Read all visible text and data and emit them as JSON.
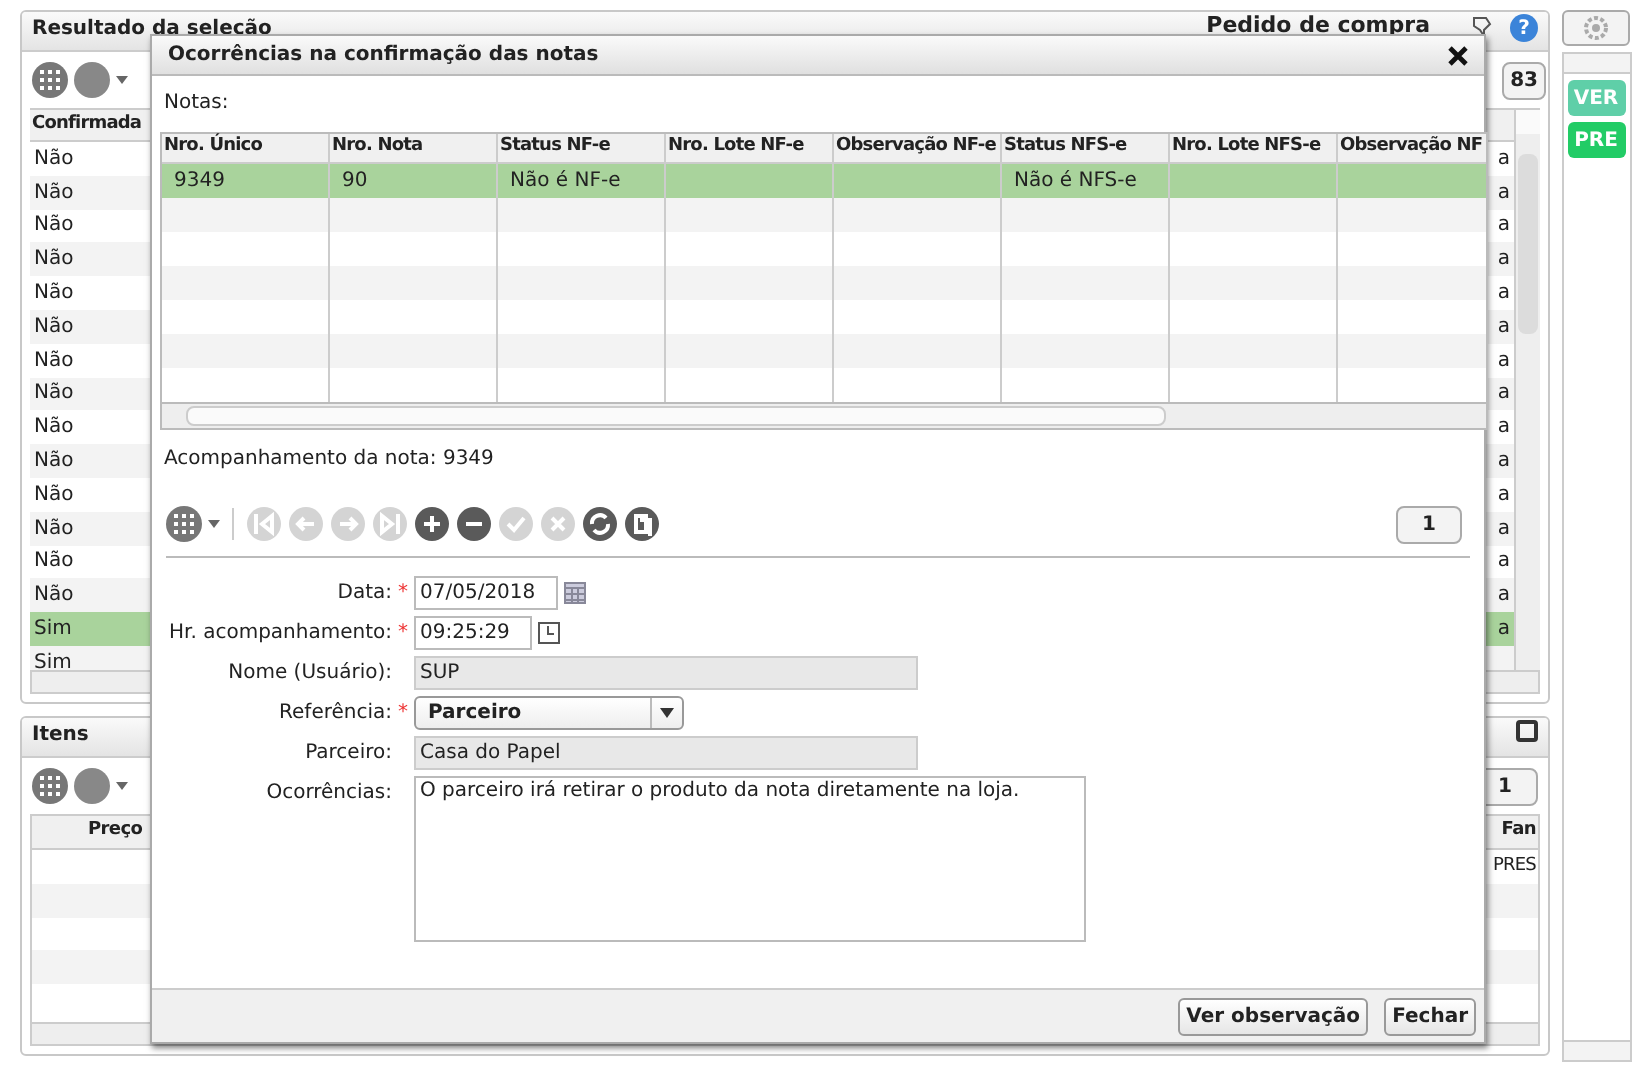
{
  "selection_panel": {
    "title": "Resultado da seleção",
    "context": "Pedido de compra",
    "help_label": "?",
    "page_badge": "83",
    "column": "Confirmada",
    "rows": [
      {
        "value": "Não",
        "column_2": "a",
        "selected": false
      },
      {
        "value": "Não",
        "column_2": "a",
        "selected": false
      },
      {
        "value": "Não",
        "column_2": "a",
        "selected": false
      },
      {
        "value": "Não",
        "column_2": "a",
        "selected": false
      },
      {
        "value": "Não",
        "column_2": "a",
        "selected": false
      },
      {
        "value": "Não",
        "column_2": "a",
        "selected": false
      },
      {
        "value": "Não",
        "column_2": "a",
        "selected": false
      },
      {
        "value": "Não",
        "column_2": "a",
        "selected": false
      },
      {
        "value": "Não",
        "column_2": "a",
        "selected": false
      },
      {
        "value": "Não",
        "column_2": "a",
        "selected": false
      },
      {
        "value": "Não",
        "column_2": "a",
        "selected": false
      },
      {
        "value": "Não",
        "column_2": "a",
        "selected": false
      },
      {
        "value": "Não",
        "column_2": "a",
        "selected": false
      },
      {
        "value": "Não",
        "column_2": "a",
        "selected": false
      },
      {
        "value": "Sim",
        "column_2": "a",
        "selected": true
      },
      {
        "value": "Sim",
        "selected": false
      }
    ]
  },
  "items_panel": {
    "title": "Itens",
    "page_badge": "1",
    "columns": [
      "Preço",
      "Fan"
    ],
    "rows": [
      {
        "cells": [
          "",
          "PRES"
        ]
      }
    ]
  },
  "sidebar": {
    "buttons": [
      {
        "label": "VER",
        "color": "#5fcfa8"
      },
      {
        "label": "PRE",
        "color": "#22cc66"
      }
    ]
  },
  "dialog": {
    "title": "Ocorrências na confirmação das notas",
    "notes_label": "Notas:",
    "columns": [
      "Nro. Único",
      "Nro. Nota",
      "Status NF-e",
      "Nro. Lote NF-e",
      "Observação NF-e",
      "Status NFS-e",
      "Nro. Lote NFS-e",
      "Observação NF"
    ],
    "rows": [
      {
        "cells": [
          "9349",
          "90",
          "Não é NF-e",
          "",
          "",
          "Não é NFS-e",
          "",
          ""
        ],
        "selected": true
      }
    ],
    "followup_label": "Acompanhamento da nota: 9349",
    "tools": [
      {
        "kind": "first",
        "disabled": true
      },
      {
        "kind": "prev",
        "disabled": true
      },
      {
        "kind": "next",
        "disabled": true
      },
      {
        "kind": "last",
        "disabled": true
      },
      {
        "kind": "add",
        "disabled": false
      },
      {
        "kind": "remove",
        "disabled": false
      },
      {
        "kind": "confirm",
        "disabled": true
      },
      {
        "kind": "cancel",
        "disabled": true
      },
      {
        "kind": "refresh",
        "disabled": false
      },
      {
        "kind": "copy",
        "disabled": false
      }
    ],
    "page_badge": "1",
    "required_mark": "*",
    "fields": [
      {
        "kind": "date",
        "label": "Data:",
        "value": "07/05/2018",
        "required": true
      },
      {
        "kind": "time",
        "label": "Hr. acompanhamento:",
        "value": "09:25:29",
        "required": true
      },
      {
        "kind": "readonly",
        "label": "Nome (Usuário):",
        "value": "SUP",
        "required": false
      },
      {
        "kind": "select",
        "label": "Referência:",
        "value": "Parceiro",
        "required": true
      },
      {
        "kind": "readonly",
        "label": "Parceiro:",
        "value": "Casa do Papel",
        "required": false
      },
      {
        "kind": "textarea",
        "label": "Ocorrências:",
        "value": "O parceiro irá retirar o produto da nota diretamente na loja.",
        "required": false
      }
    ],
    "buttons": [
      "Ver observação",
      "Fechar"
    ]
  }
}
